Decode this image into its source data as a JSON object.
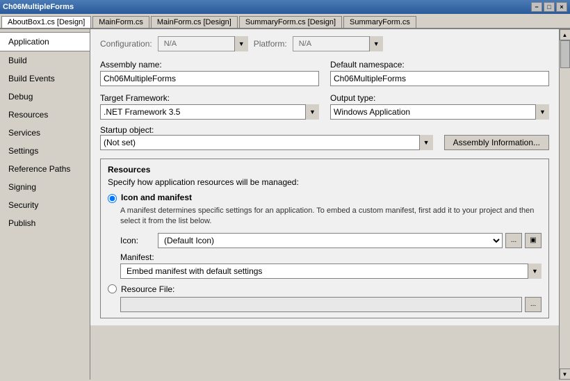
{
  "titlebar": {
    "title": "Ch06MultipleForms",
    "close": "×",
    "maximize": "□",
    "minimize": "−"
  },
  "tabs": [
    {
      "id": "about",
      "label": "AboutBox1.cs [Design]"
    },
    {
      "id": "mainform",
      "label": "MainForm.cs"
    },
    {
      "id": "mainform-design",
      "label": "MainForm.cs [Design]"
    },
    {
      "id": "summaryform",
      "label": "SummaryForm.cs [Design]"
    },
    {
      "id": "summaryform-cs",
      "label": "SummaryForm.cs"
    }
  ],
  "sidebar": {
    "items": [
      {
        "id": "application",
        "label": "Application"
      },
      {
        "id": "build",
        "label": "Build"
      },
      {
        "id": "build-events",
        "label": "Build Events"
      },
      {
        "id": "debug",
        "label": "Debug"
      },
      {
        "id": "resources",
        "label": "Resources"
      },
      {
        "id": "services",
        "label": "Services"
      },
      {
        "id": "settings",
        "label": "Settings"
      },
      {
        "id": "reference-paths",
        "label": "Reference Paths"
      },
      {
        "id": "signing",
        "label": "Signing"
      },
      {
        "id": "security",
        "label": "Security"
      },
      {
        "id": "publish",
        "label": "Publish"
      }
    ]
  },
  "content": {
    "configuration_label": "Configuration:",
    "configuration_value": "N/A",
    "platform_label": "Platform:",
    "platform_value": "N/A",
    "assembly_name_label": "Assembly name:",
    "assembly_name_value": "Ch06MultipleForms",
    "default_namespace_label": "Default namespace:",
    "default_namespace_value": "Ch06MultipleForms",
    "target_framework_label": "Target Framework:",
    "target_framework_value": ".NET Framework 3.5",
    "output_type_label": "Output type:",
    "output_type_value": "Windows Application",
    "startup_object_label": "Startup object:",
    "startup_object_value": "(Not set)",
    "assembly_info_btn": "Assembly Information...",
    "resources_section_title": "Resources",
    "resources_section_desc": "Specify how application resources will be managed:",
    "icon_manifest_label": "Icon and manifest",
    "icon_manifest_desc": "A manifest determines specific settings for an application. To embed a custom manifest, first add it to your project and then select it from the list below.",
    "icon_label": "Icon:",
    "icon_value": "(Default Icon)",
    "manifest_label": "Manifest:",
    "manifest_value": "Embed manifest with default settings",
    "resource_file_label": "Resource File:",
    "ellipsis": "...",
    "browse_icon": "▣"
  }
}
